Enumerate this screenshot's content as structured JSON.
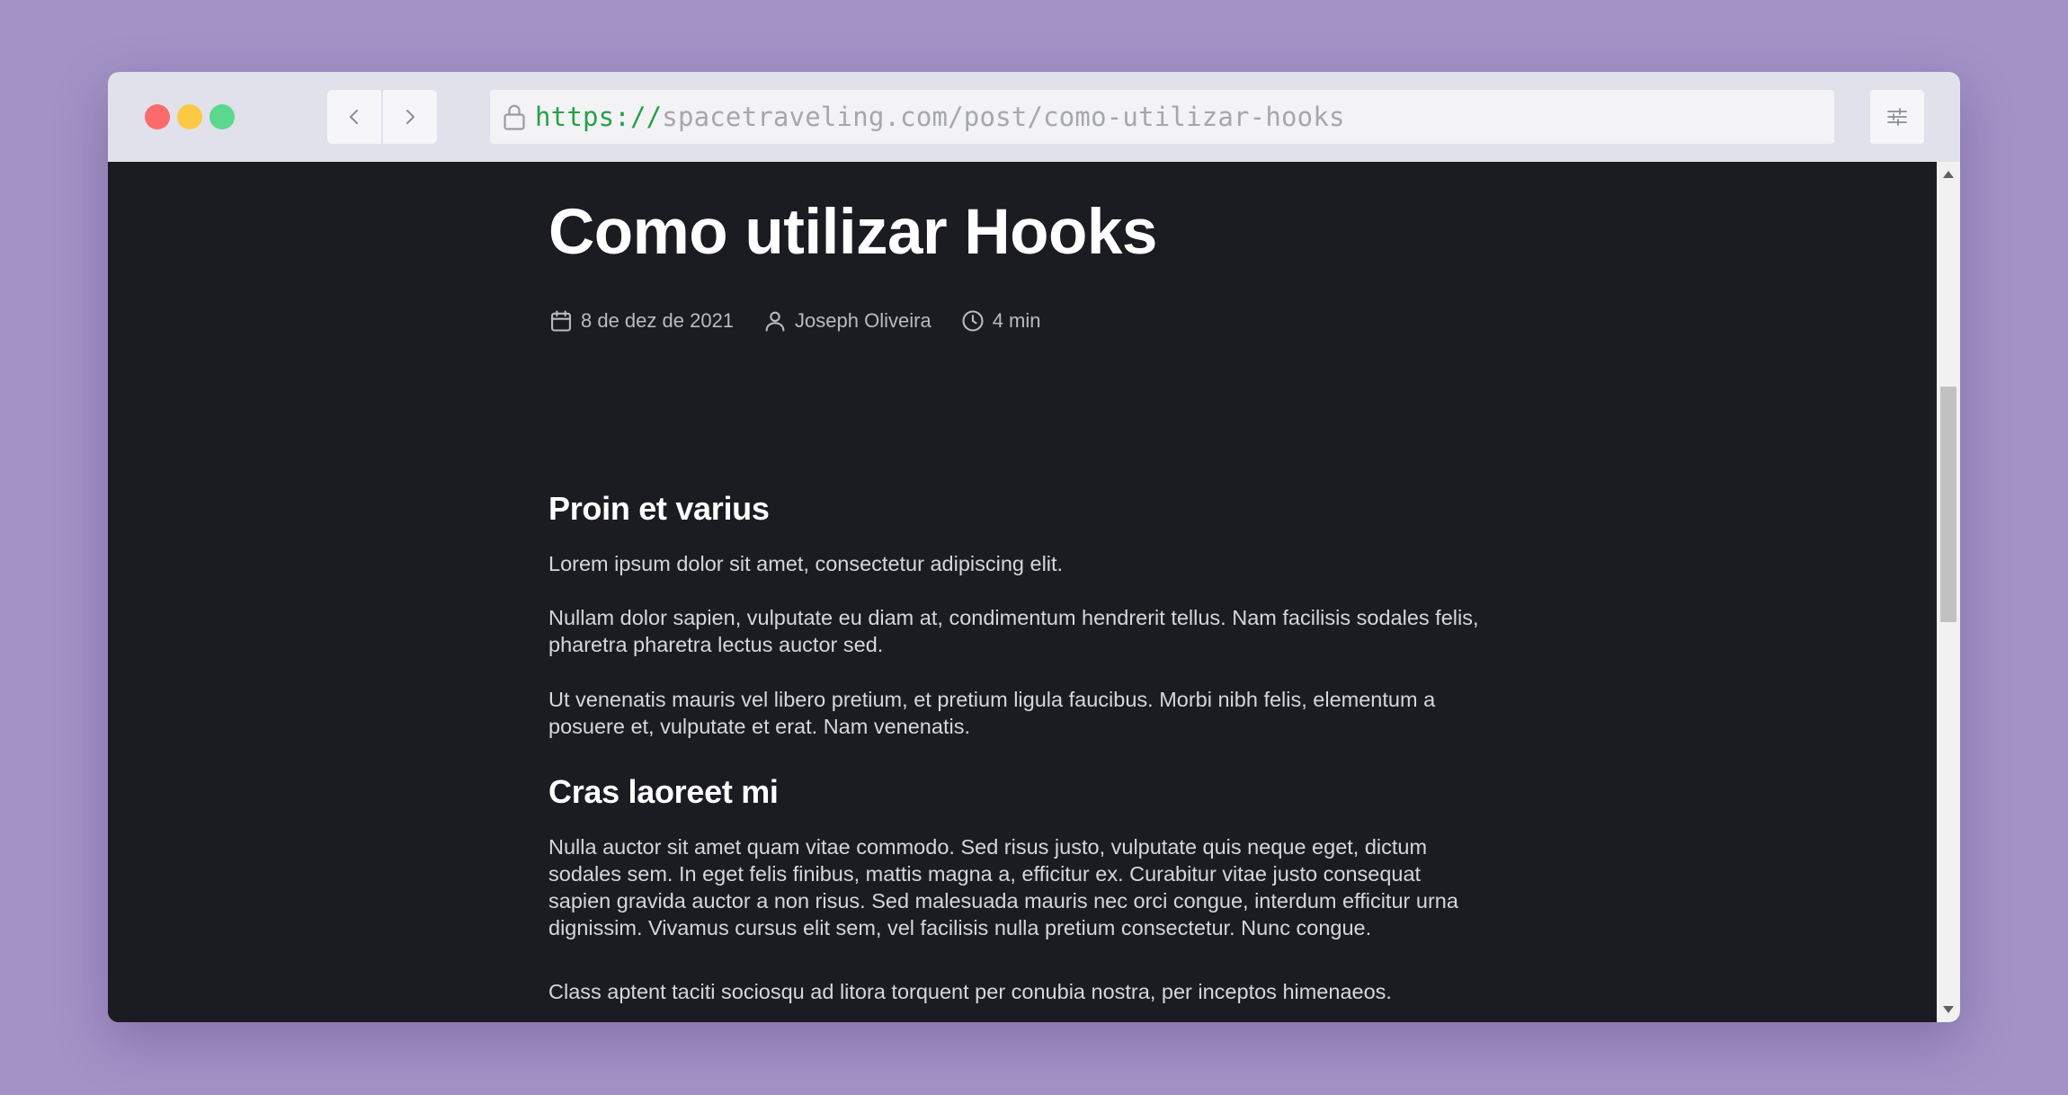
{
  "browser": {
    "url_scheme": "https://",
    "url_rest": "spacetraveling.com/post/como-utilizar-hooks"
  },
  "post": {
    "title": "Como utilizar Hooks",
    "date": "8 de dez de 2021",
    "author": "Joseph Oliveira",
    "reading_time": "4 min"
  },
  "content": {
    "section1": {
      "heading": "Proin et varius",
      "paragraphs": [
        "Lorem ipsum dolor sit amet, consectetur adipiscing elit.",
        "Nullam dolor sapien, vulputate eu diam at, condimentum hendrerit tellus. Nam facilisis sodales felis, pharetra pharetra lectus auctor sed.",
        "Ut venenatis mauris vel libero pretium, et pretium ligula faucibus. Morbi nibh felis, elementum a posuere et, vulputate et erat. Nam venenatis."
      ]
    },
    "section2": {
      "heading": "Cras laoreet mi",
      "paragraphs": [
        "Nulla auctor sit amet quam vitae commodo. Sed risus justo, vulputate quis neque eget, dictum sodales sem. In eget felis finibus, mattis magna a, efficitur ex. Curabitur vitae justo consequat sapien gravida auctor a non risus. Sed malesuada mauris nec orci congue, interdum efficitur urna dignissim. Vivamus cursus elit sem, vel facilisis nulla pretium consectetur. Nunc congue.",
        "Class aptent taciti sociosqu ad litora torquent per conubia nostra, per inceptos himenaeos."
      ]
    }
  },
  "icons": {
    "back": "chevron-left-icon",
    "forward": "chevron-right-icon",
    "lock": "lock-icon",
    "settings": "sliders-icon",
    "date": "calendar-icon",
    "author": "user-icon",
    "reading_time": "clock-icon"
  },
  "colors": {
    "background": "#a392c6",
    "page": "#1b1c22",
    "url_scheme": "#27a047"
  }
}
